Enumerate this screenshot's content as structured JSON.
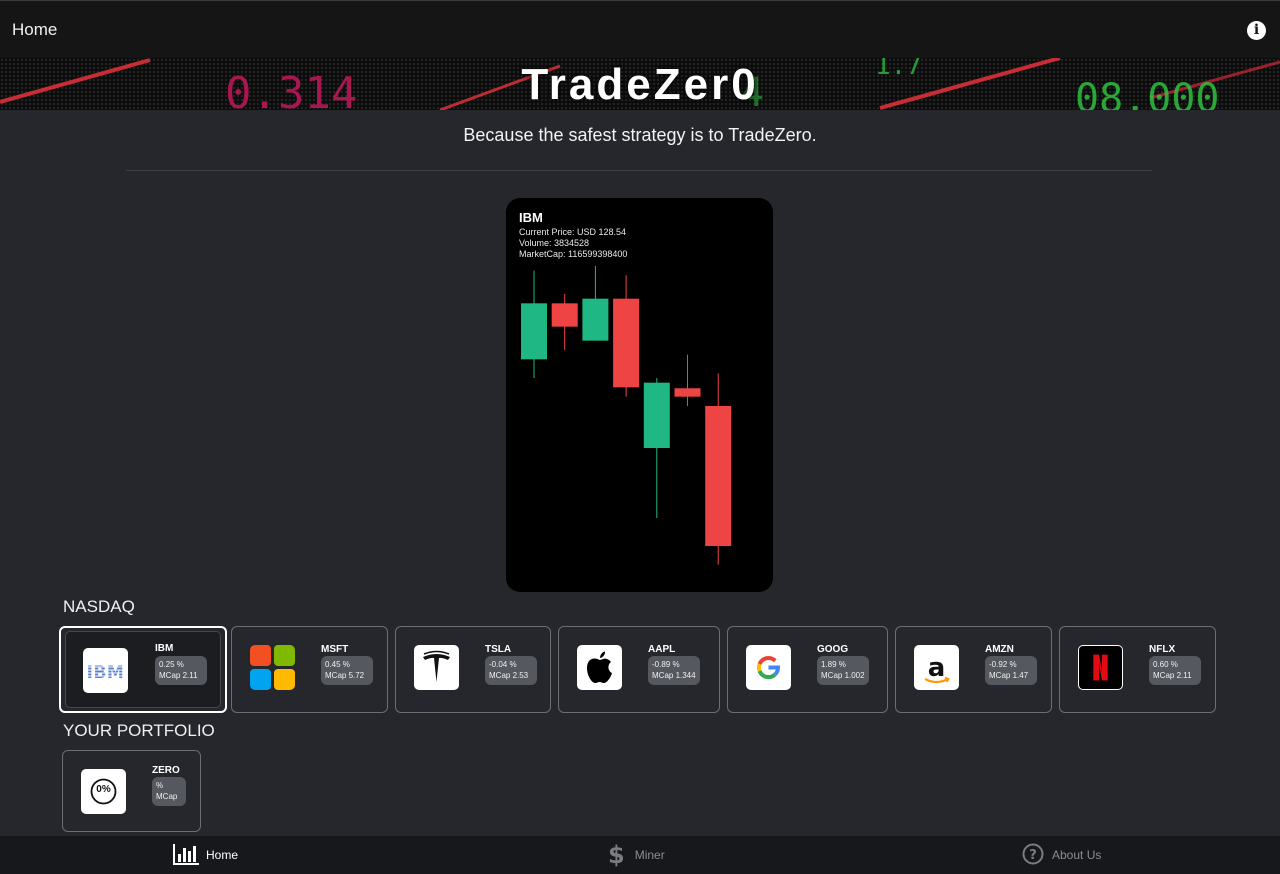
{
  "header": {
    "title": "Home",
    "info_icon": "info-icon"
  },
  "banner": {
    "brand": "TradeZer0",
    "ticker_numbers": [
      "0.314",
      "08.000",
      "1.7"
    ]
  },
  "tagline": "Because the safest strategy is to TradeZero.",
  "featured": {
    "symbol": "IBM",
    "current_price": "Current Price: USD 128.54",
    "volume": "Volume: 3834528",
    "market_cap": "MarketCap: 116599398400",
    "chart_data": {
      "type": "candlestick",
      "up_color": "#1fb884",
      "down_color": "#ef4444",
      "candles": [
        {
          "open": 121.0,
          "high": 130.5,
          "low": 119.0,
          "close": 127.0
        },
        {
          "open": 127.0,
          "high": 128.0,
          "low": 122.0,
          "close": 124.5
        },
        {
          "open": 123.0,
          "high": 131.0,
          "low": 123.0,
          "close": 127.5
        },
        {
          "open": 127.5,
          "high": 130.0,
          "low": 117.0,
          "close": 118.0
        },
        {
          "open": 111.5,
          "high": 119.0,
          "low": 104.0,
          "close": 118.5
        },
        {
          "open": 117.9,
          "high": 121.5,
          "low": 116.0,
          "close": 117.0
        },
        {
          "open": 116.0,
          "high": 119.5,
          "low": 99.0,
          "close": 101.0
        }
      ],
      "ylim": [
        98,
        131
      ]
    }
  },
  "nasdaq": {
    "label": "NASDAQ",
    "stocks": [
      {
        "symbol": "IBM",
        "change": "0.25 %",
        "mcap": "MCap 2.11",
        "logo_icon": "ibm-logo-icon",
        "selected": true
      },
      {
        "symbol": "MSFT",
        "change": "0.45 %",
        "mcap": "MCap 5.72",
        "logo_icon": "microsoft-logo-icon",
        "selected": false
      },
      {
        "symbol": "TSLA",
        "change": "-0.04 %",
        "mcap": "MCap 2.53",
        "logo_icon": "tesla-logo-icon",
        "selected": false
      },
      {
        "symbol": "AAPL",
        "change": "-0.89 %",
        "mcap": "MCap 1.344",
        "logo_icon": "apple-logo-icon",
        "selected": false
      },
      {
        "symbol": "GOOG",
        "change": "1.89 %",
        "mcap": "MCap 1.002",
        "logo_icon": "google-logo-icon",
        "selected": false
      },
      {
        "symbol": "AMZN",
        "change": "-0.92 %",
        "mcap": "MCap 1.47",
        "logo_icon": "amazon-logo-icon",
        "selected": false
      },
      {
        "symbol": "NFLX",
        "change": "0.60 %",
        "mcap": "MCap 2.11",
        "logo_icon": "netflix-logo-icon",
        "selected": false
      }
    ]
  },
  "portfolio": {
    "label": "YOUR PORTFOLIO",
    "items": [
      {
        "symbol": "ZERO",
        "change": "%",
        "mcap": "MCap",
        "logo_text": "0%",
        "logo_icon": "zero-percent-logo-icon"
      }
    ]
  },
  "bottom_nav": [
    {
      "label": "Home",
      "icon": "bar-chart-icon",
      "active": true
    },
    {
      "label": "Miner",
      "icon": "dollar-icon",
      "active": false
    },
    {
      "label": "About Us",
      "icon": "question-circle-icon",
      "active": false
    }
  ],
  "colors": {
    "background": "#25272d",
    "bar": "#151515",
    "up": "#1fb884",
    "down": "#ef4444"
  }
}
